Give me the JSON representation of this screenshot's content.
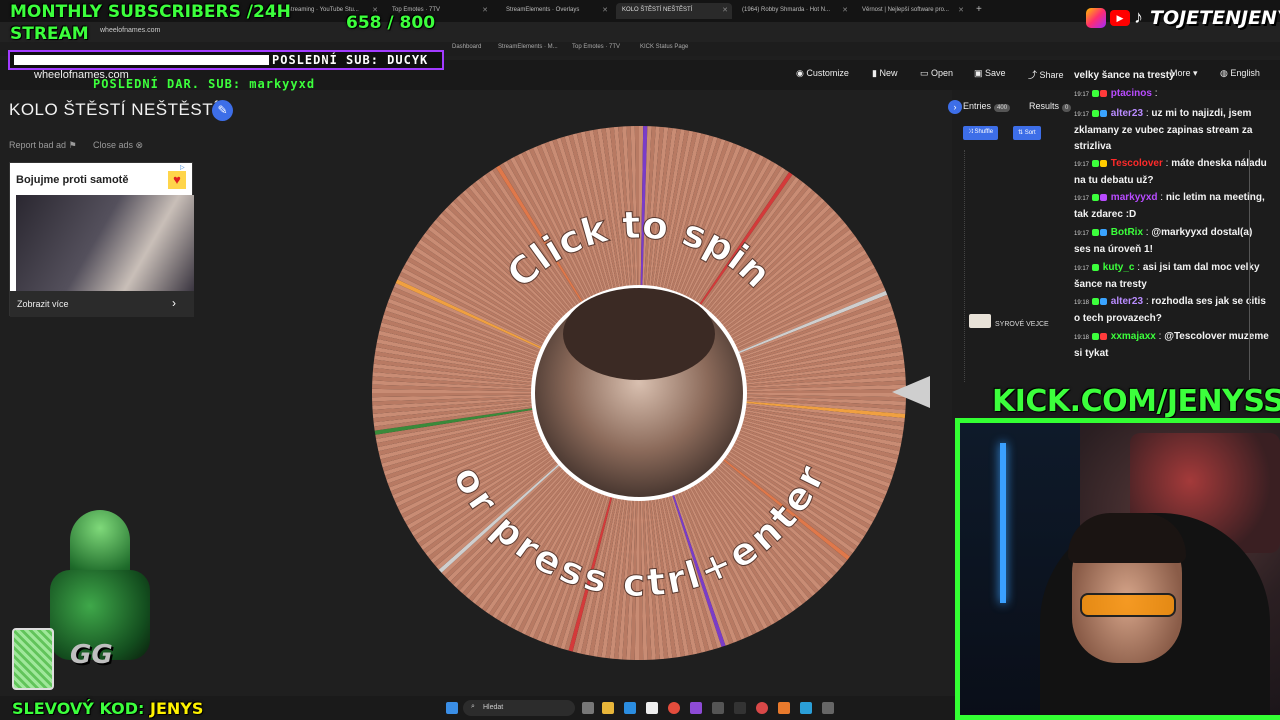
{
  "browser": {
    "tabs": [
      {
        "label": "streaming · YouTube Stu..."
      },
      {
        "label": "Top Emotes · 7TV"
      },
      {
        "label": "StreamElements · Overlays"
      },
      {
        "label": "KOLO ŠTĚSTÍ NEŠTĚSTÍ",
        "active": true
      },
      {
        "label": "(1964) Robby Shmarda · Hot N..."
      },
      {
        "label": "Věrnost | Nejlepší software pro..."
      }
    ],
    "address": "wheelofnames.com",
    "bookmarks": [
      "StreamElements · M...",
      "Top Emotes · 7TV",
      "KICK Status Page",
      "Dashboard"
    ]
  },
  "site": {
    "logo_text": "wheelofnames.com",
    "nav": {
      "customize": "Customize",
      "new": "New",
      "open": "Open",
      "save": "Save",
      "share": "Share",
      "more": "More",
      "language": "English"
    }
  },
  "overlay": {
    "subs_title": "MONTHLY SUBSCRIBERS /24H",
    "subs_title2": "STREAM",
    "subs_count": "658 / 800",
    "last_sub": "POSLEDNÍ SUB: DUCYK",
    "last_donation": "POSLEDNÍ DAR. SUB: markyyxd",
    "brand": "TOJETENJENYS",
    "kick": "KICK.COM/JENYSS",
    "promo_label": "SLEVOVÝ KOD:",
    "promo_code": "JENYS"
  },
  "page": {
    "title": "KOLO ŠTĚSTÍ NEŠTĚSTÍ",
    "report_ad": "Report bad ad",
    "close_ads": "Close ads",
    "ad": {
      "title": "Bojujme proti samotě",
      "cta": "Zobrazit více"
    }
  },
  "wheel": {
    "top_text": "Click to spin",
    "bottom_text": "or press ctrl+enter",
    "base_color": "#c98c74"
  },
  "panel": {
    "entries_label": "Entries",
    "entries_count": "400",
    "results_label": "Results",
    "results_count": "0",
    "shuffle": "Shuffle",
    "sort": "Sort",
    "visible_entry": "SYROVÉ VEJCE"
  },
  "chat": [
    {
      "time": "",
      "user": "",
      "color": "#ffffff",
      "text": "velky šance na tresty"
    },
    {
      "time": "19:17",
      "user": "ptacinos",
      "color": "#b84bff",
      "text": ""
    },
    {
      "time": "19:17",
      "user": "alter23",
      "color": "#b98cff",
      "text": "uz mi to najizdi, jsem zklamany ze vubec zapinas stream za strizliva"
    },
    {
      "time": "19:17",
      "user": "Tescolover",
      "color": "#ff2a2a",
      "text": "máte dneska náladu na tu debatu už?"
    },
    {
      "time": "19:17",
      "user": "markyyxd",
      "color": "#b84bff",
      "text": "nic letim na meeting, tak zdarec :D"
    },
    {
      "time": "19:17",
      "user": "BotRix",
      "color": "#3cff3c",
      "text": "@markyyxd dostal(a) ses na úroveň 1!"
    },
    {
      "time": "19:17",
      "user": "kuty_c",
      "color": "#3cff3c",
      "text": "asi jsi tam dal moc velky šance na tresty"
    },
    {
      "time": "19:18",
      "user": "alter23",
      "color": "#b98cff",
      "text": "rozhodla ses jak se citis o tech provazech?"
    },
    {
      "time": "19:18",
      "user": "xxmajaxx",
      "color": "#3cff3c",
      "text": "@Tescolover muzeme si tykat"
    }
  ],
  "taskbar": {
    "search": "Hledat"
  }
}
